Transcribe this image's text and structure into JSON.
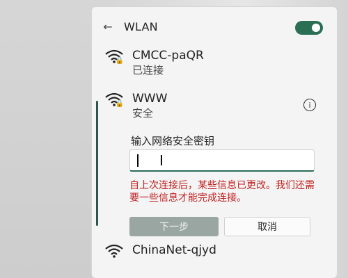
{
  "header": {
    "title": "WLAN",
    "toggle_state": "on"
  },
  "networks": [
    {
      "name": "CMCC-paQR",
      "status": "已连接"
    },
    {
      "name": "WWW",
      "status": "安全"
    },
    {
      "name": "ChinaNet-qjyd",
      "status": ""
    }
  ],
  "connect": {
    "prompt": "输入网络安全密钥",
    "password_value": "",
    "error": "自上次连接后，某些信息已更改。我们还需要一些信息才能完成连接。",
    "next_label": "下一步",
    "cancel_label": "取消"
  },
  "colors": {
    "accent": "#2d6a5a",
    "toggle_on": "#2a6f55",
    "error": "#c02020"
  }
}
